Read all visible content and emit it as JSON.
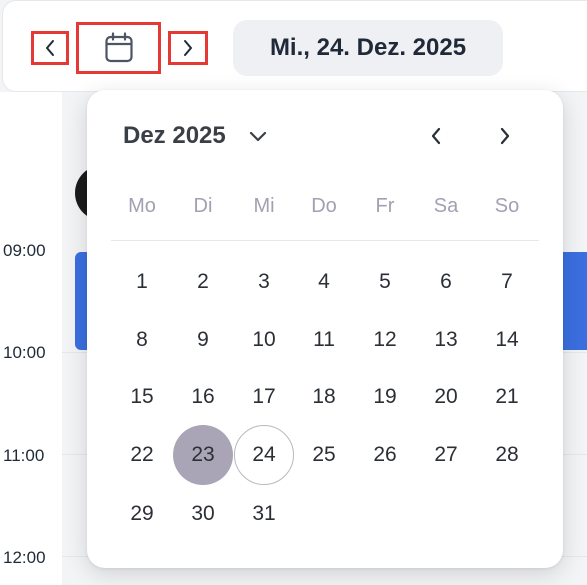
{
  "toolbar": {
    "prev_icon": "chevron-left-icon",
    "calendar_icon": "calendar-icon",
    "next_icon": "chevron-right-icon",
    "date_label": "Mi., 24. Dez. 2025",
    "highlight_color": "#e53935"
  },
  "timeline": {
    "hours": [
      "09:00",
      "10:00",
      "11:00",
      "12:00"
    ],
    "event_color": "#3b6fe0"
  },
  "datepicker": {
    "month_label": "Dez 2025",
    "dropdown_icon": "chevron-down-icon",
    "prev_month_icon": "chevron-left-icon",
    "next_month_icon": "chevron-right-icon",
    "weekdays": [
      "Mo",
      "Di",
      "Mi",
      "Do",
      "Fr",
      "Sa",
      "So"
    ],
    "weeks": [
      [
        "1",
        "2",
        "3",
        "4",
        "5",
        "6",
        "7"
      ],
      [
        "8",
        "9",
        "10",
        "11",
        "12",
        "13",
        "14"
      ],
      [
        "15",
        "16",
        "17",
        "18",
        "19",
        "20",
        "21"
      ],
      [
        "22",
        "23",
        "24",
        "25",
        "26",
        "27",
        "28"
      ],
      [
        "29",
        "30",
        "31",
        "",
        "",
        "",
        ""
      ]
    ],
    "selected_day": "23",
    "today": "24",
    "selected_color": "#a9a5b6"
  }
}
